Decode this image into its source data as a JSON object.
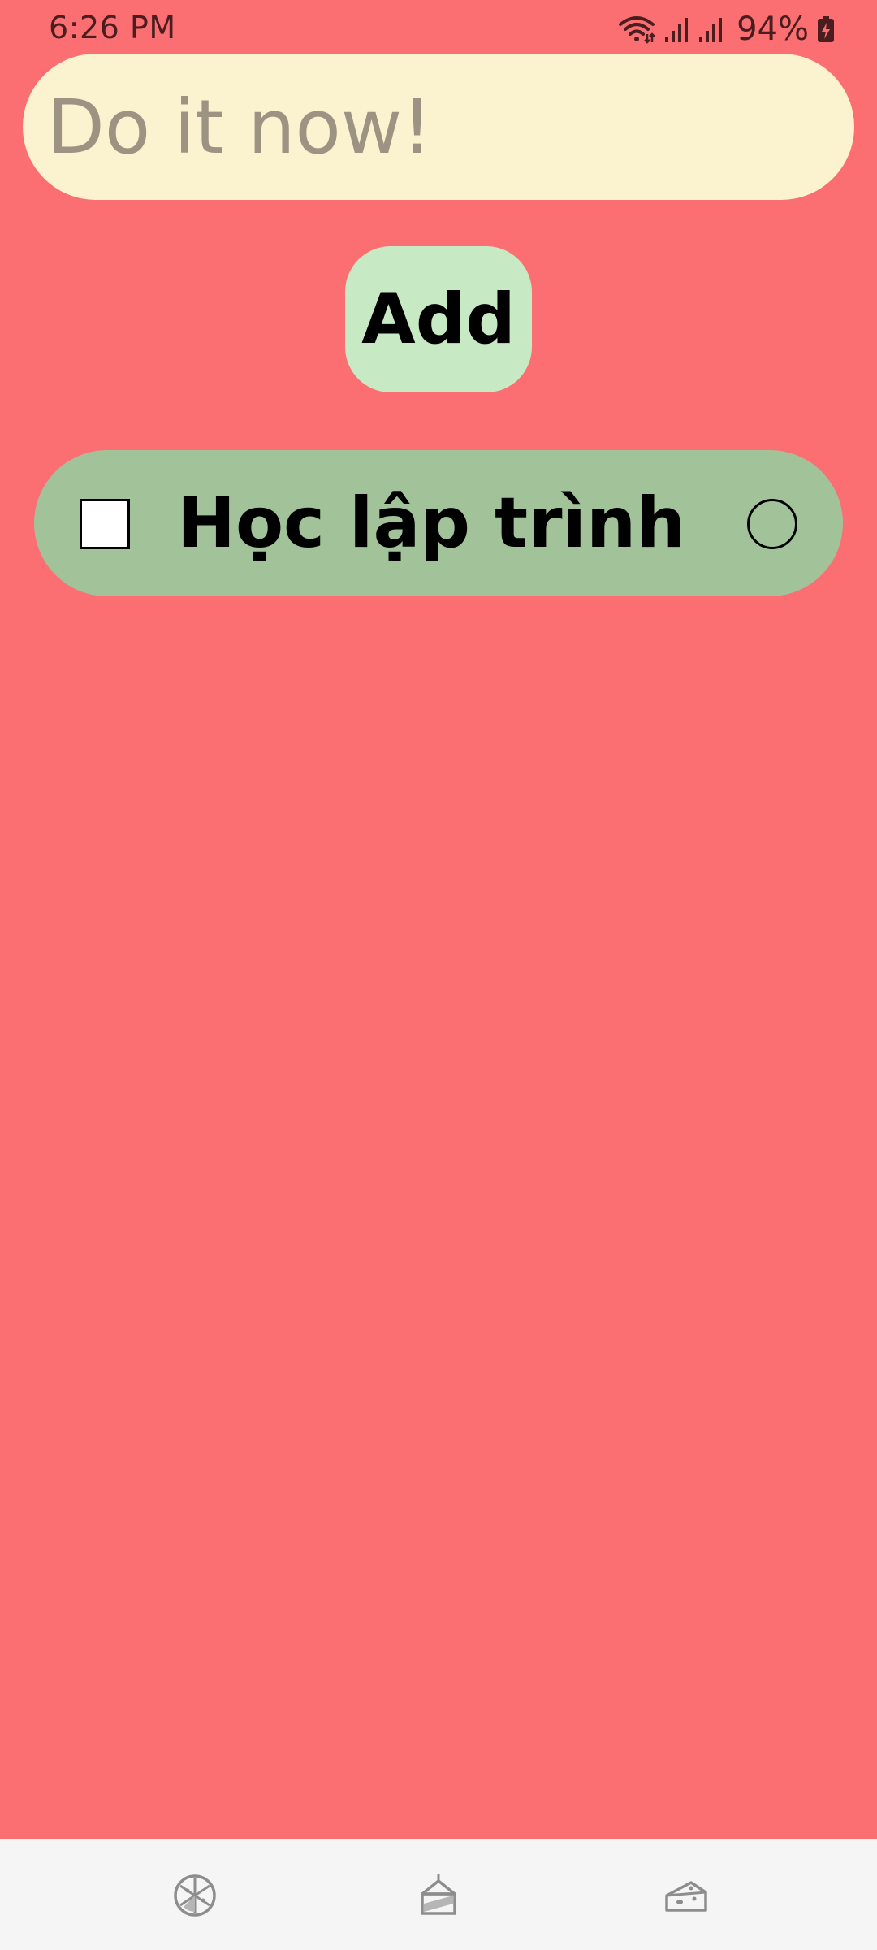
{
  "status_bar": {
    "time": "6:26 PM",
    "battery": "94%",
    "icons": [
      "wifi-icon",
      "signal-icon",
      "signal-icon",
      "battery-charging-icon"
    ]
  },
  "task_input": {
    "placeholder": "Do it now!",
    "value": ""
  },
  "add_button": {
    "label": "Add"
  },
  "tasks": [
    {
      "label": "Học lập trình",
      "checked": false
    }
  ],
  "bottom_nav": {
    "items": [
      {
        "icon": "pizza-icon"
      },
      {
        "icon": "cake-slice-icon"
      },
      {
        "icon": "cheese-icon"
      }
    ]
  },
  "colors": {
    "background": "#fb6f73",
    "input_background": "#fbf3cf",
    "add_button_background": "#c7e9c3",
    "task_background": "#a2c399",
    "nav_background": "#f5f5f5"
  }
}
